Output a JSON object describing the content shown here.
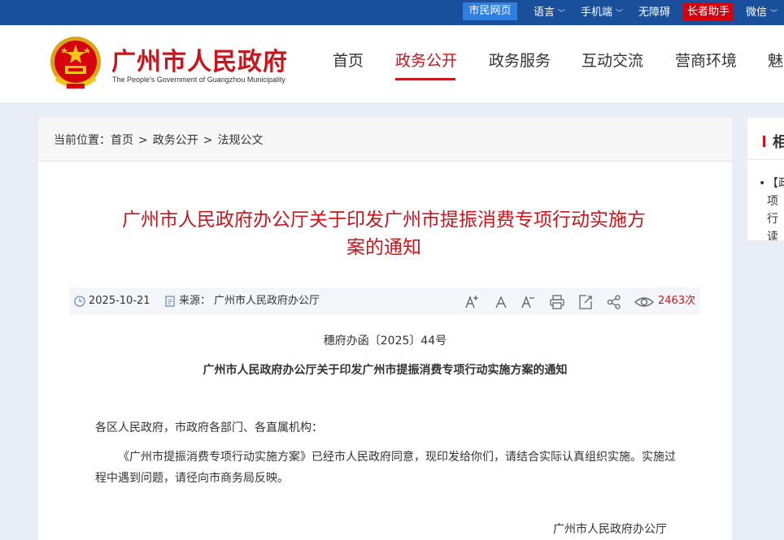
{
  "topbar": {
    "citizen_label": "市民网页",
    "language_label": "语言",
    "mobile_label": "手机端",
    "accessibility_label": "无障碍",
    "elder_label": "长者助手",
    "wechat_label": "微信"
  },
  "header": {
    "site_title": "广州市人民政府",
    "site_subtitle": "The People's Government of Guangzhou Municipality",
    "nav": [
      {
        "label": "首页"
      },
      {
        "label": "政务公开"
      },
      {
        "label": "政务服务"
      },
      {
        "label": "互动交流"
      },
      {
        "label": "营商环境"
      },
      {
        "label": "魅"
      }
    ]
  },
  "breadcrumb": {
    "prefix": "当前位置：",
    "items": [
      "首页",
      "政务公开",
      "法规公文"
    ],
    "separator": ">"
  },
  "article": {
    "title": "广州市人民政府办公厅关于印发广州市提振消费专项行动实施方案的通知",
    "date": "2025-10-21",
    "source_label": "来源：",
    "source": "广州市人民政府办公厅",
    "views": "2463",
    "views_unit": "次",
    "doc_number": "穗府办函〔2025〕44号",
    "doc_heading": "广州市人民政府办公厅关于印发广州市提振消费专项行动实施方案的通知",
    "salutation": "各区人民政府，市政府各部门、各直属机构：",
    "body": "《广州市提振消费专项行动实施方案》已经市人民政府同意，现印发给你们，请结合实际认真组织实施。实施过程中遇到问题，请径向市商务局反映。",
    "signature": "广州市人民政府办公厅"
  },
  "sidebar": {
    "heading": "相",
    "item": "【政项行读"
  },
  "colors": {
    "brand_red": "#c8161d",
    "topbar_blue": "#1a4f9c",
    "citizen_blue": "#2f7fe0",
    "elder_red": "#d7000f"
  }
}
